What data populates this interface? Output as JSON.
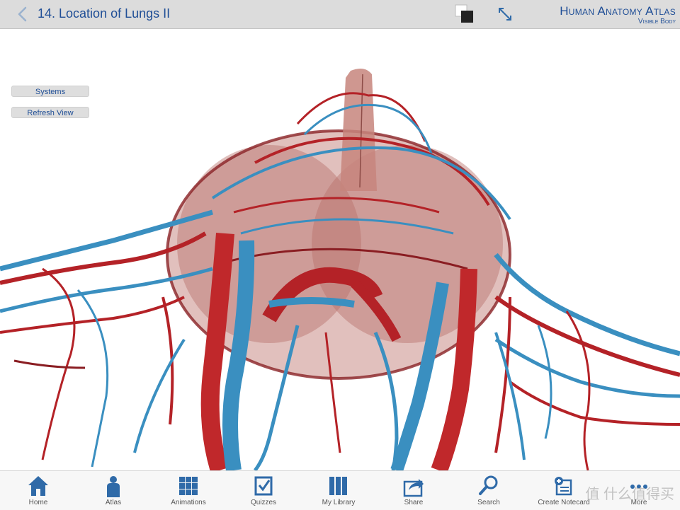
{
  "header": {
    "back_label": "<",
    "title": "14. Location of Lungs II",
    "brand_main": "Human Anatomy Atlas",
    "brand_sub": "Visible Body"
  },
  "side_buttons": {
    "systems": "Systems",
    "refresh": "Refresh View"
  },
  "tabs": [
    {
      "label": "Home",
      "icon": "home-icon"
    },
    {
      "label": "Atlas",
      "icon": "person-icon"
    },
    {
      "label": "Animations",
      "icon": "grid-icon"
    },
    {
      "label": "Quizzes",
      "icon": "checkbox-icon"
    },
    {
      "label": "My Library",
      "icon": "books-icon"
    },
    {
      "label": "Share",
      "icon": "share-icon"
    },
    {
      "label": "Search",
      "icon": "search-icon"
    },
    {
      "label": "Create Notecard",
      "icon": "notecard-icon"
    },
    {
      "label": "More",
      "icon": "more-icon"
    }
  ],
  "watermark": "值 什么值得买",
  "colors": {
    "accent": "#1f4e96",
    "artery": "#c0282b",
    "vein": "#3a8fc0",
    "tissue": "#c8837a"
  }
}
